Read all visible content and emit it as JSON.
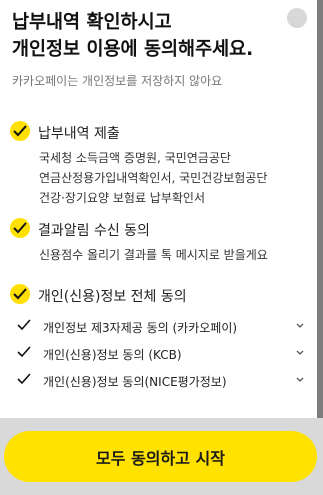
{
  "header": {
    "title": "납부내역 확인하시고\n개인정보 이용에 동의해주세요.",
    "subtitle": "카카오페이는 개인정보를 저장하지 않아요"
  },
  "sections": [
    {
      "title": "납부내역 제출",
      "lines": [
        "국세청 소득금액 증명원, 국민연금공단",
        "연금산정용가입내역확인서, 국민건강보험공단",
        "건강·장기요양 보험료 납부확인서"
      ]
    },
    {
      "title": "결과알림 수신 동의",
      "lines": [
        "신용점수 올리기 결과를 톡 메시지로 받을게요"
      ]
    },
    {
      "title": "개인(신용)정보 전체 동의",
      "lines": []
    }
  ],
  "consents": [
    {
      "label": "개인정보 제3자제공 동의 (카카오페이)"
    },
    {
      "label": "개인(신용)정보 동의 (KCB)"
    },
    {
      "label": "개인(신용)정보 동의(NICE평가정보)"
    }
  ],
  "cta": {
    "label": "모두 동의하고 시작"
  },
  "colors": {
    "accent": "#ffe200",
    "overlay": "#8a8a8a"
  },
  "icons": {
    "check": "check-icon",
    "chevron": "chevron-down-icon"
  }
}
